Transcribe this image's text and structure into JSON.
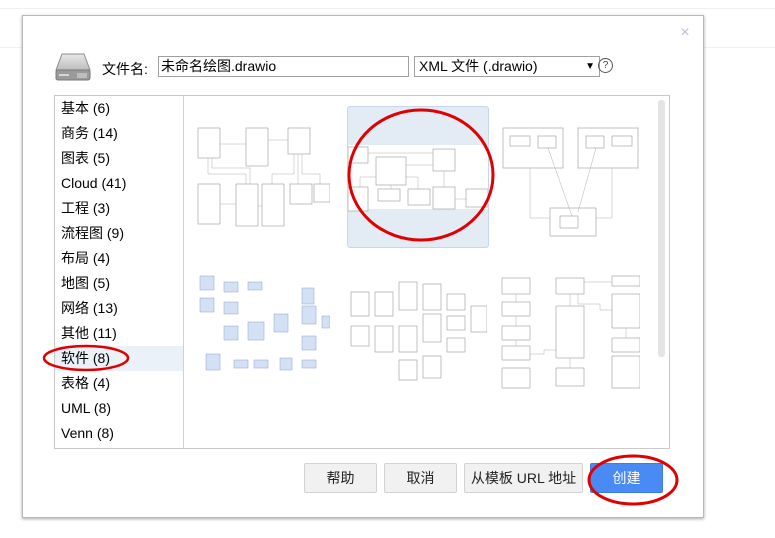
{
  "dialog": {
    "close_icon": "×",
    "filename_label": "文件名:",
    "filename_value": "未命名绘图.drawio",
    "format_selected": "XML 文件 (.drawio)",
    "format_arrow": "▼",
    "help_icon": "?"
  },
  "categories": [
    {
      "label": "基本 (6)"
    },
    {
      "label": "商务 (14)"
    },
    {
      "label": "图表 (5)"
    },
    {
      "label": "Cloud (41)"
    },
    {
      "label": "工程 (3)"
    },
    {
      "label": "流程图 (9)"
    },
    {
      "label": "布局 (4)"
    },
    {
      "label": "地图 (5)"
    },
    {
      "label": "网络 (13)"
    },
    {
      "label": "其他 (11)"
    },
    {
      "label": "软件 (8)",
      "selected": true
    },
    {
      "label": "表格 (4)"
    },
    {
      "label": "UML (8)"
    },
    {
      "label": "Venn (8)"
    }
  ],
  "templates": [
    {
      "name": "uml-class-diagram"
    },
    {
      "name": "uml-class-diagram-selected",
      "selected": true
    },
    {
      "name": "component-diagram"
    },
    {
      "name": "entity-relationship-blue"
    },
    {
      "name": "database-tables"
    },
    {
      "name": "table-schema"
    }
  ],
  "buttons": {
    "help": "帮助",
    "cancel": "取消",
    "from_url": "从模板 URL 地址",
    "create": "创建"
  },
  "colors": {
    "primary": "#4a8af4",
    "selection": "#ebf1f9",
    "annotation": "#e00000"
  }
}
